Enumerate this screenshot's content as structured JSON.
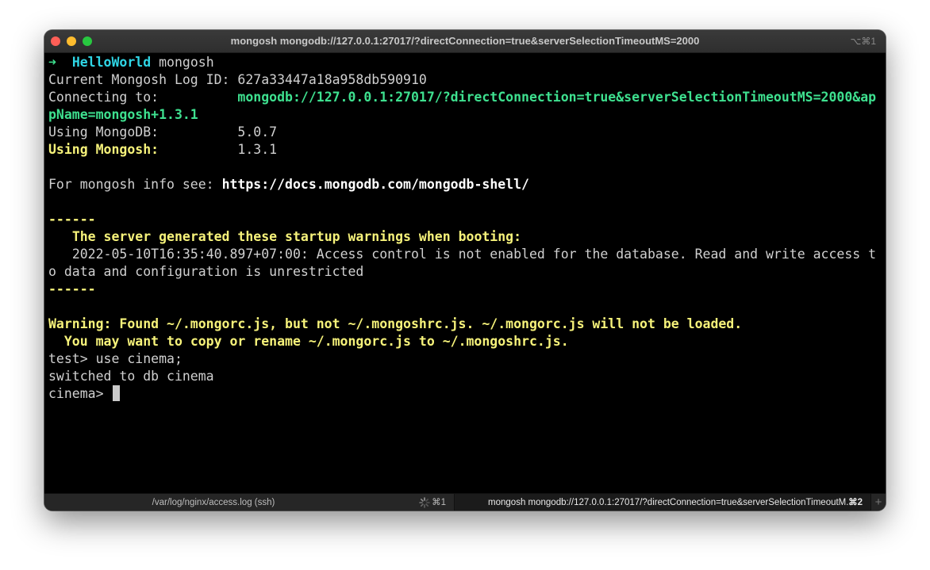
{
  "window": {
    "title": "mongosh mongodb://127.0.0.1:27017/?directConnection=true&serverSelectionTimeoutMS=2000",
    "shortcut": "⌥⌘1"
  },
  "terminal": {
    "prompt_arrow": "➜",
    "prompt_dir": "HelloWorld",
    "prompt_cmd": "mongosh",
    "log_id_label": "Current Mongosh Log ID:",
    "log_id_value": "627a33447a18a958db590910",
    "connecting_label": "Connecting to:",
    "connecting_value_1": "mongodb://127.0.0.1:27017/?directConnection=true&serverSelectionTimeoutMS=2000&ap",
    "connecting_value_2": "pName=mongosh+1.3.1",
    "mongodb_label": "Using MongoDB:",
    "mongodb_value": "5.0.7",
    "mongosh_label": "Using Mongosh:",
    "mongosh_value": "1.3.1",
    "info_label": "For mongosh info see:",
    "info_url": "https://docs.mongodb.com/mongodb-shell/",
    "separator": "------",
    "warnings_header": "The server generated these startup warnings when booting:",
    "warning_line_1": "2022-05-10T16:35:40.897+07:00: Access control is not enabled for the database. Read and write access t",
    "warning_line_2": "o data and configuration is unrestricted",
    "rc_warning_1": "Warning: Found ~/.mongorc.js, but not ~/.mongoshrc.js. ~/.mongorc.js will not be loaded.",
    "rc_warning_2": "You may want to copy or rename ~/.mongorc.js to ~/.mongoshrc.js.",
    "cmd_prompt": "test>",
    "cmd_text": "use cinema;",
    "cmd_output": "switched to db cinema",
    "current_prompt": "cinema>"
  },
  "tabs": [
    {
      "label": "/var/log/nginx/access.log (ssh)",
      "shortcut": "⌘1"
    },
    {
      "label": "mongosh mongodb://127.0.0.1:27017/?directConnection=true&serverSelectionTimeoutM...",
      "shortcut": "⌘2"
    }
  ],
  "new_tab": "+",
  "colors": {
    "green": "#3ee08f",
    "cyan": "#2fd6e6",
    "yellow": "#f6f27a",
    "background": "#000000"
  }
}
